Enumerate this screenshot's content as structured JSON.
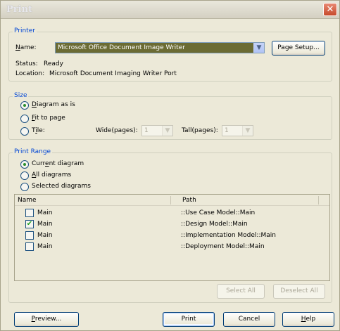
{
  "window": {
    "title": "Print",
    "close_glyph": "✕"
  },
  "printer": {
    "legend": "Printer",
    "name_label": "Name:",
    "name_value": "Microsoft Office Document Image Writer",
    "page_setup": "Page Setup...",
    "status_label": "Status:",
    "status_value": "Ready",
    "location_label": "Location:",
    "location_value": "Microsoft Document Imaging Writer Port"
  },
  "size": {
    "legend": "Size",
    "options": [
      "Diagram as is",
      "Fit to page",
      "Tile:"
    ],
    "selected_index": 0,
    "wide_label": "Wide(pages):",
    "wide_value": "1",
    "tall_label": "Tall(pages):",
    "tall_value": "1"
  },
  "print_range": {
    "legend": "Print Range",
    "options": [
      "Current diagram",
      "All diagrams",
      "Selected diagrams"
    ],
    "selected_index": 0,
    "columns": [
      "Name",
      "Path"
    ],
    "rows": [
      {
        "name": "Main",
        "path": "::Use Case Model::Main",
        "checked": false
      },
      {
        "name": "Main",
        "path": "::Design Model::Main",
        "checked": true
      },
      {
        "name": "Main",
        "path": "::Implementation Model::Main",
        "checked": false
      },
      {
        "name": "Main",
        "path": "::Deployment Model::Main",
        "checked": false
      }
    ],
    "select_all": "Select All",
    "deselect_all": "Deselect All"
  },
  "buttons": {
    "preview": "Preview...",
    "print": "Print",
    "cancel": "Cancel",
    "help": "Help"
  },
  "icons": {
    "check": "✔",
    "dropdown_arrow": "▼"
  }
}
